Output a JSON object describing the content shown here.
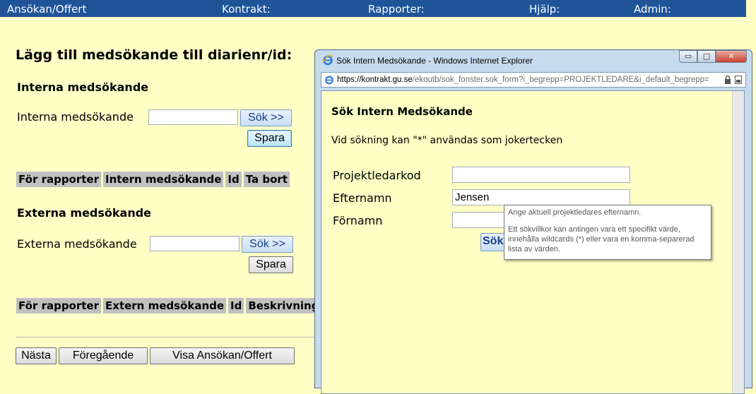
{
  "nav": {
    "items": [
      "Ansökan/Offert",
      "Kontrakt:",
      "Rapporter:",
      "Hjälp:",
      "Admin:"
    ]
  },
  "main": {
    "title": "Lägg till medsökande till diarienr/id:",
    "internal": {
      "heading": "Interna medsökande",
      "label": "Interna medsökande",
      "search_button": "Sök >>",
      "save_button": "Spara",
      "columns": [
        "För rapporter",
        "Intern medsökande",
        "Id",
        "Ta bort"
      ]
    },
    "external": {
      "heading": "Externa medsökande",
      "label": "Externa medsökande",
      "search_button": "Sök >>",
      "save_button": "Spara",
      "columns": [
        "För rapporter",
        "Extern medsökande",
        "Id",
        "Beskrivning"
      ]
    },
    "footer_buttons": [
      "Nästa",
      "Föregående",
      "Visa Ansökan/Offert"
    ]
  },
  "popup": {
    "window_title": "Sök Intern Medsökande - Windows Internet Explorer",
    "url_host": "https://kontrakt.gu.se",
    "url_path": "/ekoutb/sok_fonster.sok_form?i_begrepp=PROJEKTLEDARE&i_default_begrepp=",
    "heading": "Sök Intern Medsökande",
    "hint": "Vid sökning kan \"*\" användas som jokertecken",
    "fields": [
      {
        "label": "Projektledarkod",
        "value": ""
      },
      {
        "label": "Efternamn",
        "value": "Jensen"
      },
      {
        "label": "Förnamn",
        "value": ""
      }
    ],
    "search_button_partial": "Sök",
    "tooltip": {
      "line1": "Ange aktuell projektledares efternamn.",
      "line2": "Ett sökvillkor kan antingen vara ett specifikt värde, innehålla wildcards (*) eller vara en komma-separerad lista av värden."
    },
    "controls": {
      "minimize": "▭",
      "maximize": "□",
      "close": "✕"
    }
  },
  "colors": {
    "nav_bg": "#1f5499",
    "page_bg": "#ffffc6",
    "table_header_bg": "#c0c0c0"
  }
}
